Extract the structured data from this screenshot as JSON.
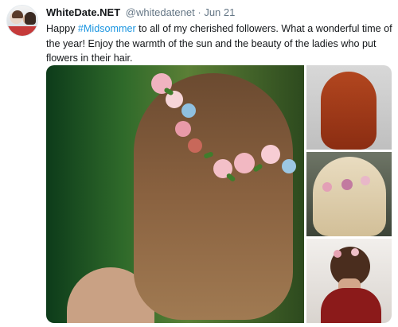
{
  "tweet": {
    "display_name": "WhiteDate.NET",
    "handle": "@whitedatenet",
    "separator": "·",
    "date": "Jun 21",
    "text_before": "Happy ",
    "hashtag": "#Midsommer",
    "text_after": " to all of my cherished followers. What a wonderful time of the year! Enjoy the warmth of the sun and the beauty of the ladies who put flowers in their hair."
  },
  "colors": {
    "link": "#1b95e0",
    "secondary_text": "#657786",
    "primary_text": "#14171a"
  },
  "media": {
    "images": [
      "main-photo-flower-crown",
      "photo-red-hair-flowers",
      "photo-blonde-hair-flowers",
      "photo-updo-red-dress"
    ]
  }
}
